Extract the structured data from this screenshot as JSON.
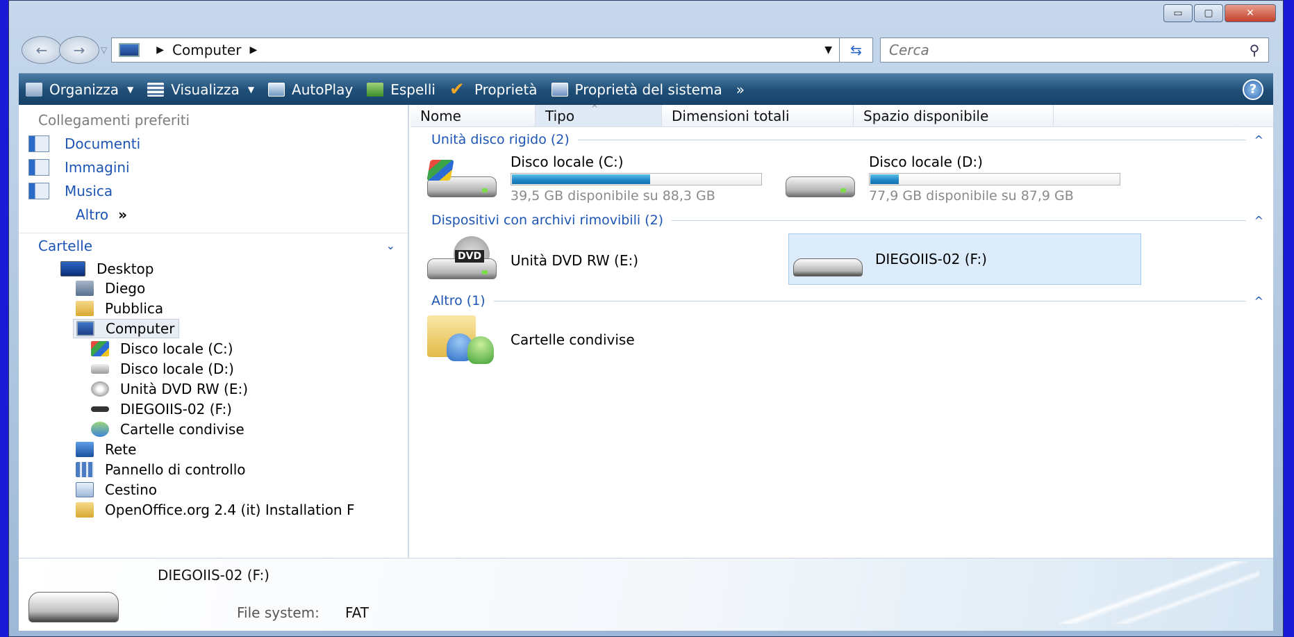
{
  "window": {
    "minimize": "▭",
    "maximize": "▢",
    "close": "✕"
  },
  "address": {
    "path_root": "Computer",
    "dropdown": "▼"
  },
  "search": {
    "placeholder": "Cerca"
  },
  "toolbar": {
    "organize": "Organizza",
    "view": "Visualizza",
    "autoplay": "AutoPlay",
    "eject": "Espelli",
    "properties": "Proprietà",
    "system_properties": "Proprietà del sistema",
    "more": "»",
    "help": "?"
  },
  "nav": {
    "favorites_title": "Collegamenti preferiti",
    "favorites": [
      {
        "label": "Documenti"
      },
      {
        "label": "Immagini"
      },
      {
        "label": "Musica"
      }
    ],
    "more_label": "Altro",
    "more_chevron": "»",
    "folders_title": "Cartelle",
    "tree": [
      {
        "label": "Desktop",
        "icon": "desktop-icon"
      },
      {
        "label": "Diego",
        "icon": "user-folder-icon"
      },
      {
        "label": "Pubblica",
        "icon": "folder-icon"
      },
      {
        "label": "Computer",
        "icon": "computer-icon"
      },
      {
        "label": "Disco locale (C:)",
        "icon": "system-drive-icon"
      },
      {
        "label": "Disco locale (D:)",
        "icon": "drive-icon"
      },
      {
        "label": "Unità DVD RW (E:)",
        "icon": "dvd-icon"
      },
      {
        "label": "DIEGOIIS-02 (F:)",
        "icon": "usb-drive-icon"
      },
      {
        "label": "Cartelle condivise",
        "icon": "shared-folder-icon"
      },
      {
        "label": "Rete",
        "icon": "network-icon"
      },
      {
        "label": "Pannello di controllo",
        "icon": "control-panel-icon"
      },
      {
        "label": "Cestino",
        "icon": "recycle-bin-icon"
      },
      {
        "label": "OpenOffice.org 2.4 (it) Installation F",
        "icon": "folder-icon"
      }
    ]
  },
  "columns": [
    "Nome",
    "Tipo",
    "Dimensioni totali",
    "Spazio disponibile"
  ],
  "groups": {
    "hdd": "Unità disco rigido (2)",
    "removable": "Dispositivi con archivi rimovibili (2)",
    "other": "Altro (1)"
  },
  "drives": {
    "c": {
      "name": "Disco locale (C:)",
      "free_text": "39,5 GB disponibile su 88,3 GB",
      "used_fraction": 0.553
    },
    "d": {
      "name": "Disco locale (D:)",
      "free_text": "77,9 GB disponibile su 87,9 GB",
      "used_fraction": 0.114
    },
    "e": {
      "name": "Unità DVD RW (E:)",
      "badge": "DVD"
    },
    "f": {
      "name": "DIEGOIIS-02 (F:)"
    },
    "shared": {
      "name": "Cartelle condivise"
    }
  },
  "details": {
    "name": "DIEGOIIS-02 (F:)",
    "fs_label": "File system:",
    "fs_value": "FAT"
  },
  "colors": {
    "accent": "#1d55b5",
    "toolbar": "#1e4e77",
    "selection": "#dcecfb",
    "bar_fill": "#1f86c6"
  }
}
